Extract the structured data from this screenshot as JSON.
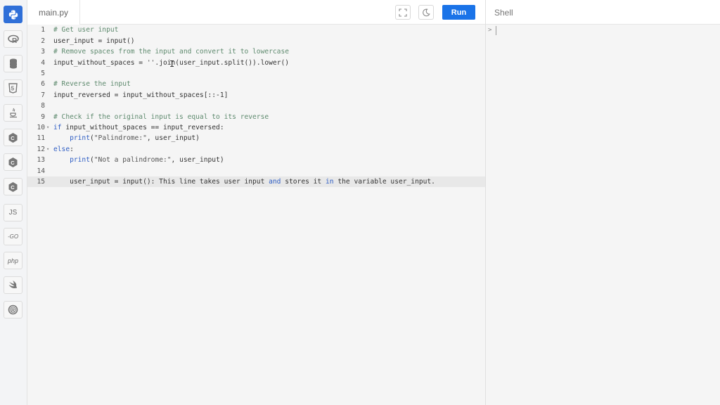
{
  "sidebar": {
    "languages": [
      {
        "name": "python-icon",
        "label": ""
      },
      {
        "name": "r-icon",
        "label": ""
      },
      {
        "name": "database-icon",
        "label": ""
      },
      {
        "name": "html5-icon",
        "label": ""
      },
      {
        "name": "java-icon",
        "label": ""
      },
      {
        "name": "c-icon",
        "label": ""
      },
      {
        "name": "cpp-icon",
        "label": ""
      },
      {
        "name": "csharp-icon",
        "label": ""
      },
      {
        "name": "js-icon",
        "label": "JS"
      },
      {
        "name": "go-icon",
        "label": "-GO"
      },
      {
        "name": "php-icon",
        "label": "php"
      },
      {
        "name": "swift-icon",
        "label": ""
      },
      {
        "name": "rust-icon",
        "label": ""
      }
    ]
  },
  "editor": {
    "tab_label": "main.py",
    "run_label": "Run",
    "lines": [
      [
        {
          "t": "# Get user input",
          "c": "cm"
        }
      ],
      [
        {
          "t": "user_input = input()",
          "c": ""
        }
      ],
      [
        {
          "t": "# Remove spaces from the input and convert it to lowercase",
          "c": "cm"
        }
      ],
      [
        {
          "t": "input_without_spaces = ",
          "c": ""
        },
        {
          "t": "''",
          "c": "st"
        },
        {
          "t": ".join(user_input.split()).lower()",
          "c": ""
        }
      ],
      [],
      [
        {
          "t": "# Reverse the input",
          "c": "cm"
        }
      ],
      [
        {
          "t": "input_reversed = input_without_spaces[::-1]",
          "c": ""
        }
      ],
      [],
      [
        {
          "t": "# Check if the original input is equal to its reverse",
          "c": "cm"
        }
      ],
      [
        {
          "t": "if",
          "c": "kw"
        },
        {
          "t": " input_without_spaces == input_reversed:",
          "c": ""
        }
      ],
      [
        {
          "t": "    ",
          "c": ""
        },
        {
          "t": "print",
          "c": "kw"
        },
        {
          "t": "(",
          "c": ""
        },
        {
          "t": "\"Palindrome:\"",
          "c": "st"
        },
        {
          "t": ", user_input)",
          "c": ""
        }
      ],
      [
        {
          "t": "else",
          "c": "kw"
        },
        {
          "t": ":",
          "c": ""
        }
      ],
      [
        {
          "t": "    ",
          "c": ""
        },
        {
          "t": "print",
          "c": "kw"
        },
        {
          "t": "(",
          "c": ""
        },
        {
          "t": "\"Not a palindrome:\"",
          "c": "st"
        },
        {
          "t": ", user_input)",
          "c": ""
        }
      ],
      [],
      [
        {
          "t": "    user_input = input(): This line takes user input ",
          "c": ""
        },
        {
          "t": "and",
          "c": "kw"
        },
        {
          "t": " stores it ",
          "c": ""
        },
        {
          "t": "in",
          "c": "kw"
        },
        {
          "t": " the variable user_input.",
          "c": ""
        }
      ]
    ],
    "folds": [
      10,
      12
    ],
    "active_line": 15
  },
  "shell": {
    "title": "Shell",
    "prompt": ">"
  },
  "colors": {
    "accent": "#1a73e8",
    "active_language": "#2f6fd8"
  }
}
